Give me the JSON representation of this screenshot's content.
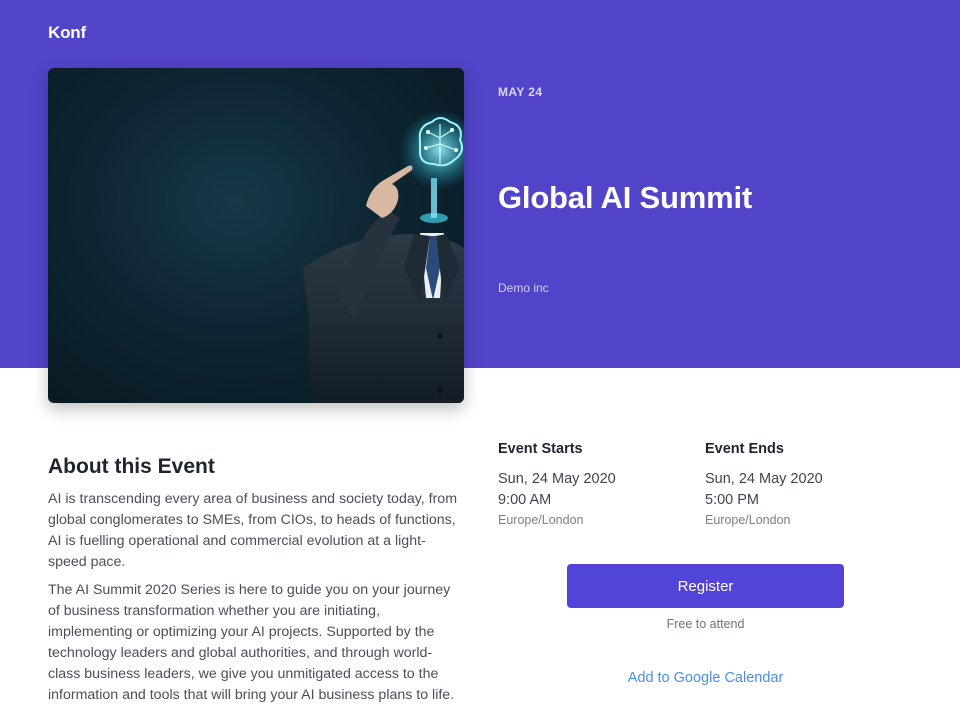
{
  "header": {
    "brand": "Konf"
  },
  "event": {
    "date_label": "MAY 24",
    "title": "Global AI Summit",
    "organizer": "Demo inc",
    "image_alt": "Businessman pointing at glowing circuit brain"
  },
  "about": {
    "heading": "About this Event",
    "paragraphs": [
      "AI is transcending every area of business and society today, from global conglomerates to SMEs, from CIOs, to heads of functions, AI is fuelling operational and commercial evolution at a light-speed pace.",
      "The AI Summit 2020 Series is here to guide you on your journey of business transformation whether you are initiating, implementing or optimizing your AI projects. Supported by the technology leaders and global authorities, and through world-class business leaders, we give you unmitigated access to the information and tools that will bring your AI business plans to life."
    ]
  },
  "schedule": {
    "start": {
      "label": "Event Starts",
      "date": "Sun, 24 May 2020",
      "time": "9:00 AM",
      "timezone": "Europe/London"
    },
    "end": {
      "label": "Event Ends",
      "date": "Sun, 24 May 2020",
      "time": "5:00 PM",
      "timezone": "Europe/London"
    }
  },
  "actions": {
    "register_label": "Register",
    "free_note": "Free to attend",
    "calendar_link": "Add to Google Calendar"
  },
  "colors": {
    "hero": "#5244c9",
    "button": "#5244d9",
    "link": "#4a8ee8"
  }
}
